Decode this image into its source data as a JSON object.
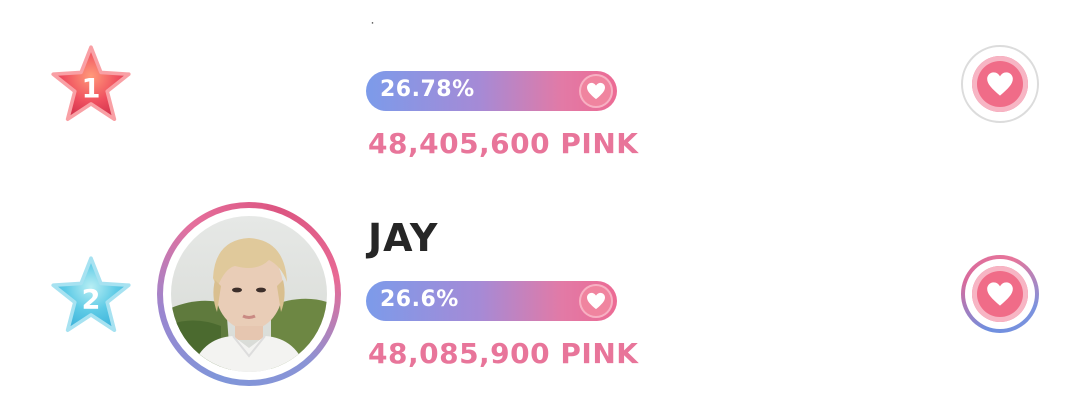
{
  "ranking": [
    {
      "rank": "1",
      "name": "˙",
      "percent": "26.78%",
      "percent_value": 26.78,
      "points": "48,405,600 PINK",
      "star_color": "#e8465e",
      "has_avatar": false
    },
    {
      "rank": "2",
      "name": "JAY",
      "percent": "26.6%",
      "percent_value": 26.6,
      "points": "48,085,900 PINK",
      "star_color": "#5ac8e8",
      "has_avatar": true
    }
  ],
  "colors": {
    "accent_pink": "#e8759a",
    "bar_start": "#7c9bea",
    "bar_end": "#ec6b94",
    "heart": "#f06c88"
  },
  "icons": {
    "bar_heart": "heart-icon",
    "vote": "heart-icon",
    "rank": "star-icon"
  }
}
